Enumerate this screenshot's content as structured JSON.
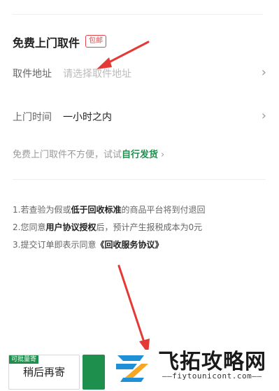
{
  "pickup": {
    "title": "免费上门取件",
    "badge": "包邮",
    "address_label": "取件地址",
    "address_placeholder": "请选择取件地址",
    "time_label": "上门时间",
    "time_value": "一小时之内"
  },
  "hint": {
    "text": "免费上门取件不方便，试试",
    "link": "自行发货"
  },
  "notes": {
    "n1_pre": "1.若查验为假或",
    "n1_bold": "低于回收标准",
    "n1_post": "的商品平台将到付退回",
    "n2_pre": "2.您同意",
    "n2_bold": "用户协议授权",
    "n2_post": "后，预计产生报税成本为0元",
    "n3_pre": "3.提交订单即表示同意",
    "n3_bold": "《回收服务协议》"
  },
  "bottom": {
    "tag": "可批量寄",
    "later_label": "稍后再寄"
  },
  "watermark": {
    "brand": "飞拓攻略网",
    "url": "——fiytounicont.com——"
  },
  "icons": {
    "chevron": "chevron-right-icon"
  },
  "colors": {
    "accent_green": "#1f8f4e",
    "badge_red": "#e0454a",
    "arrow_red": "#e53935"
  }
}
